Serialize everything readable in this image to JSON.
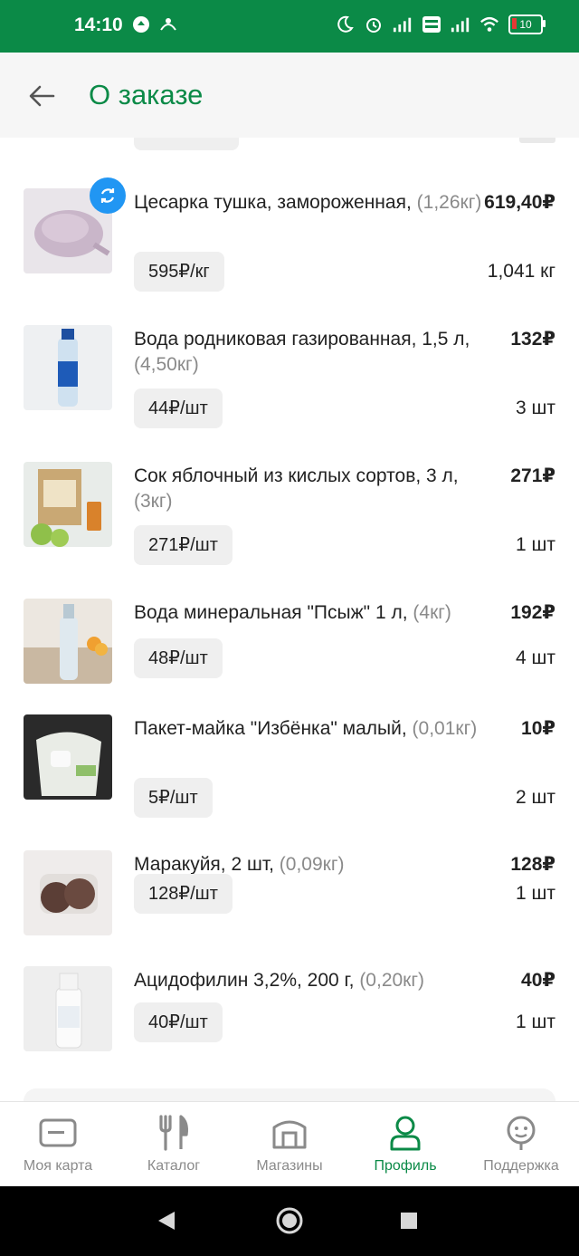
{
  "status_bar": {
    "time": "14:10",
    "battery": "10"
  },
  "header": {
    "title": "О заказе"
  },
  "items": [
    {
      "name": "Цесарка тушка, замороженная,",
      "weight": "(1,26кг)",
      "price": "619,40₽",
      "unit_price": "595₽/кг",
      "qty": "1,041 кг"
    },
    {
      "name": "Вода родниковая газированная, 1,5 л,",
      "weight": "(4,50кг)",
      "price": "132₽",
      "unit_price": "44₽/шт",
      "qty": "3 шт"
    },
    {
      "name": "Сок яблочный из кислых сортов, 3 л,",
      "weight": "(3кг)",
      "price": "271₽",
      "unit_price": "271₽/шт",
      "qty": "1 шт"
    },
    {
      "name": "Вода минеральная \"Псыж\" 1 л,",
      "weight": "(4кг)",
      "price": "192₽",
      "unit_price": "48₽/шт",
      "qty": "4 шт"
    },
    {
      "name": "Пакет-майка \"Избёнка\" малый,",
      "weight": "(0,01кг)",
      "price": "10₽",
      "unit_price": "5₽/шт",
      "qty": "2 шт"
    },
    {
      "name": "Маракуйя, 2 шт,",
      "weight": "(0,09кг)",
      "price": "128₽",
      "unit_price": "128₽/шт",
      "qty": "1 шт"
    },
    {
      "name": "Ацидофилин 3,2%, 200 г,",
      "weight": "(0,20кг)",
      "price": "40₽",
      "unit_price": "40₽/шт",
      "qty": "1 шт"
    }
  ],
  "bottom_nav": [
    {
      "label": "Моя карта",
      "icon": "card-icon"
    },
    {
      "label": "Каталог",
      "icon": "fork-knife-icon"
    },
    {
      "label": "Магазины",
      "icon": "store-icon"
    },
    {
      "label": "Профиль",
      "icon": "profile-icon",
      "active": true
    },
    {
      "label": "Поддержка",
      "icon": "support-icon"
    }
  ],
  "colors": {
    "brand_green": "#0b8a47",
    "badge_blue": "#2196f3"
  }
}
